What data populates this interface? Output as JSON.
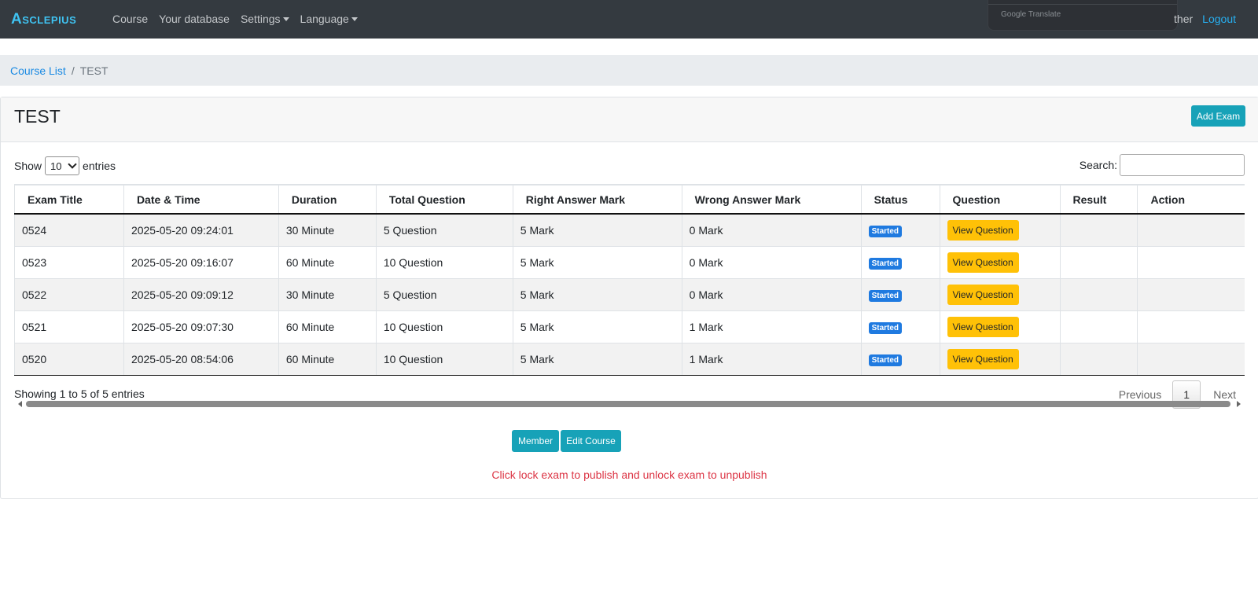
{
  "navbar": {
    "brand": "Asclepius",
    "links": [
      "Course",
      "Your database",
      "Settings",
      "Language"
    ],
    "translate_label": "Google Translate",
    "teacher_fragment": "ther",
    "logout": "Logout"
  },
  "breadcrumb": {
    "parent": "Course List",
    "separator": "/",
    "current": "TEST"
  },
  "card": {
    "title": "TEST",
    "add_exam": "Add Exam"
  },
  "controls": {
    "show": "Show",
    "entries_value": "10",
    "entries": "entries",
    "search_label": "Search:"
  },
  "table": {
    "headers": [
      "Exam Title",
      "Date & Time",
      "Duration",
      "Total Question",
      "Right Answer Mark",
      "Wrong Answer Mark",
      "Status",
      "Question",
      "Result",
      "Action"
    ],
    "rows": [
      {
        "title": "0524",
        "datetime": "2025-05-20 09:24:01",
        "duration": "30 Minute",
        "total": "5 Question",
        "right": "5 Mark",
        "wrong": "0 Mark",
        "status": "Started",
        "question_btn": "View Question",
        "result": "",
        "action": ""
      },
      {
        "title": "0523",
        "datetime": "2025-05-20 09:16:07",
        "duration": "60 Minute",
        "total": "10 Question",
        "right": "5 Mark",
        "wrong": "0 Mark",
        "status": "Started",
        "question_btn": "View Question",
        "result": "",
        "action": ""
      },
      {
        "title": "0522",
        "datetime": "2025-05-20 09:09:12",
        "duration": "30 Minute",
        "total": "5 Question",
        "right": "5 Mark",
        "wrong": "0 Mark",
        "status": "Started",
        "question_btn": "View Question",
        "result": "",
        "action": ""
      },
      {
        "title": "0521",
        "datetime": "2025-05-20 09:07:30",
        "duration": "60 Minute",
        "total": "10 Question",
        "right": "5 Mark",
        "wrong": "1 Mark",
        "status": "Started",
        "question_btn": "View Question",
        "result": "",
        "action": ""
      },
      {
        "title": "0520",
        "datetime": "2025-05-20 08:54:06",
        "duration": "60 Minute",
        "total": "10 Question",
        "right": "5 Mark",
        "wrong": "1 Mark",
        "status": "Started",
        "question_btn": "View Question",
        "result": "",
        "action": ""
      }
    ]
  },
  "footer": {
    "info": "Showing 1 to 5 of 5 entries",
    "previous": "Previous",
    "page": "1",
    "next": "Next",
    "member": "Member",
    "edit_course": "Edit Course",
    "notice": "Click lock exam to publish and unlock exam to unpublish"
  },
  "colors": {
    "navbar_bg": "#343a40",
    "brand": "#3fc3f2",
    "info": "#17a2b8",
    "warning": "#ffc107",
    "badge": "#1f7ae0",
    "danger": "#dc3545"
  }
}
